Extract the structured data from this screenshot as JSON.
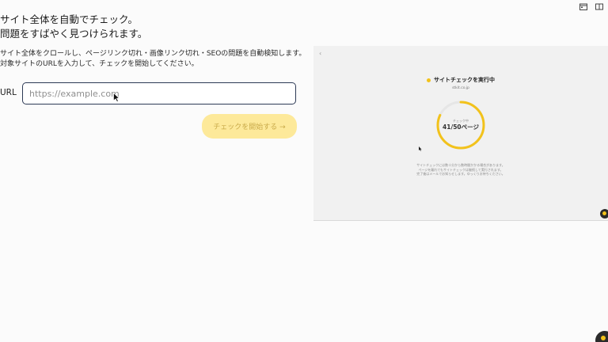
{
  "headline": {
    "line1": "サイト全体を自動でチェック。",
    "line2": "問題をすばやく見つけられます。"
  },
  "description": {
    "line1": "サイト全体をクロールし、ページリンク切れ・画像リンク切れ・SEOの問題を自動検知します。",
    "line2": "対象サイトのURLを入力して、チェックを開始してください。"
  },
  "form": {
    "url_label": "URL",
    "url_placeholder": "https://example.com",
    "url_value": "",
    "start_button": "チェックを開始する →"
  },
  "preview": {
    "title": "サイトチェックを実行中",
    "domain": "stkit.co.jp",
    "progress_label": "チェック中",
    "progress_text": "41/50ページ",
    "progress_done": 41,
    "progress_total": 50,
    "note_line1": "サイトチェックには数十分から数時間かかる場合があります。",
    "note_line2": "ページを離れてもサイトチェックは継続して実行されます。",
    "note_line3": "完了後はメールでお知らせします。ゆっくりお待ちください。"
  },
  "icons": {
    "calendar": "calendar-icon",
    "book": "book-icon",
    "accent": "#f2c21b"
  }
}
